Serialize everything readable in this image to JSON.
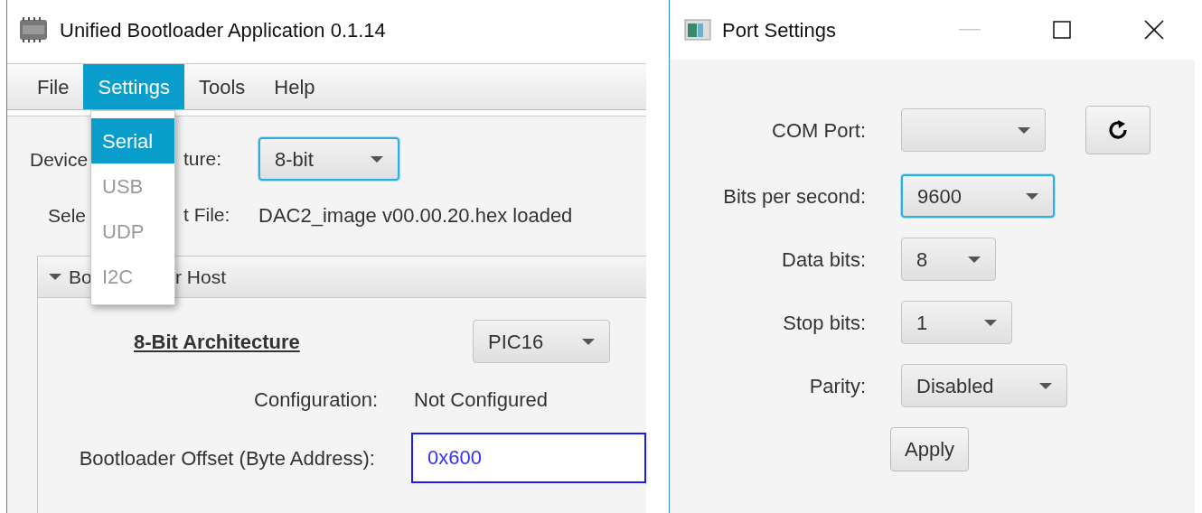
{
  "main_window": {
    "title": "Unified Bootloader Application 0.1.14",
    "menu": [
      {
        "label": "File",
        "selected": false
      },
      {
        "label": "Settings",
        "selected": true
      },
      {
        "label": "Tools",
        "selected": false
      },
      {
        "label": "Help",
        "selected": false
      }
    ],
    "open_menu": [
      {
        "label": "Serial",
        "selected": true,
        "disabled": false
      },
      {
        "label": "USB",
        "selected": false,
        "disabled": true
      },
      {
        "label": "UDP",
        "selected": false,
        "disabled": true
      },
      {
        "label": "I2C",
        "selected": false,
        "disabled": true
      }
    ],
    "device_architecture": {
      "label_parts": [
        "Device",
        "ture:"
      ],
      "value": "8-bit",
      "focused": true
    },
    "selected_file": {
      "label_parts": [
        "Sele",
        "t File:"
      ],
      "value": "DAC2_image v00.00.20.hex loaded"
    },
    "bootloader_host": {
      "title_parts": [
        "Bo",
        "r Host"
      ],
      "expanded": true,
      "heading": "8-Bit Architecture",
      "family": {
        "value": "PIC16",
        "focused": false
      },
      "fields": [
        {
          "kind": "text",
          "label": "Configuration:",
          "value": "Not Configured"
        },
        {
          "kind": "input",
          "label": "Bootloader Offset (Byte Address):",
          "value": "0x600",
          "focused": true
        }
      ]
    }
  },
  "port_settings": {
    "title": "Port Settings",
    "minimize_disabled": true,
    "fields": [
      {
        "kind": "combo_refresh",
        "label": "COM Port:",
        "focused": false
      },
      {
        "kind": "combo",
        "label": "Bits per second:",
        "value": "9600",
        "focused": true
      },
      {
        "kind": "combo",
        "label": "Data bits:",
        "value": "8",
        "focused": false
      },
      {
        "kind": "combo",
        "label": "Stop bits:",
        "value": "1",
        "focused": false
      },
      {
        "kind": "combo",
        "label": "Parity:",
        "value": "Disabled",
        "focused": false
      }
    ],
    "apply": "Apply"
  }
}
